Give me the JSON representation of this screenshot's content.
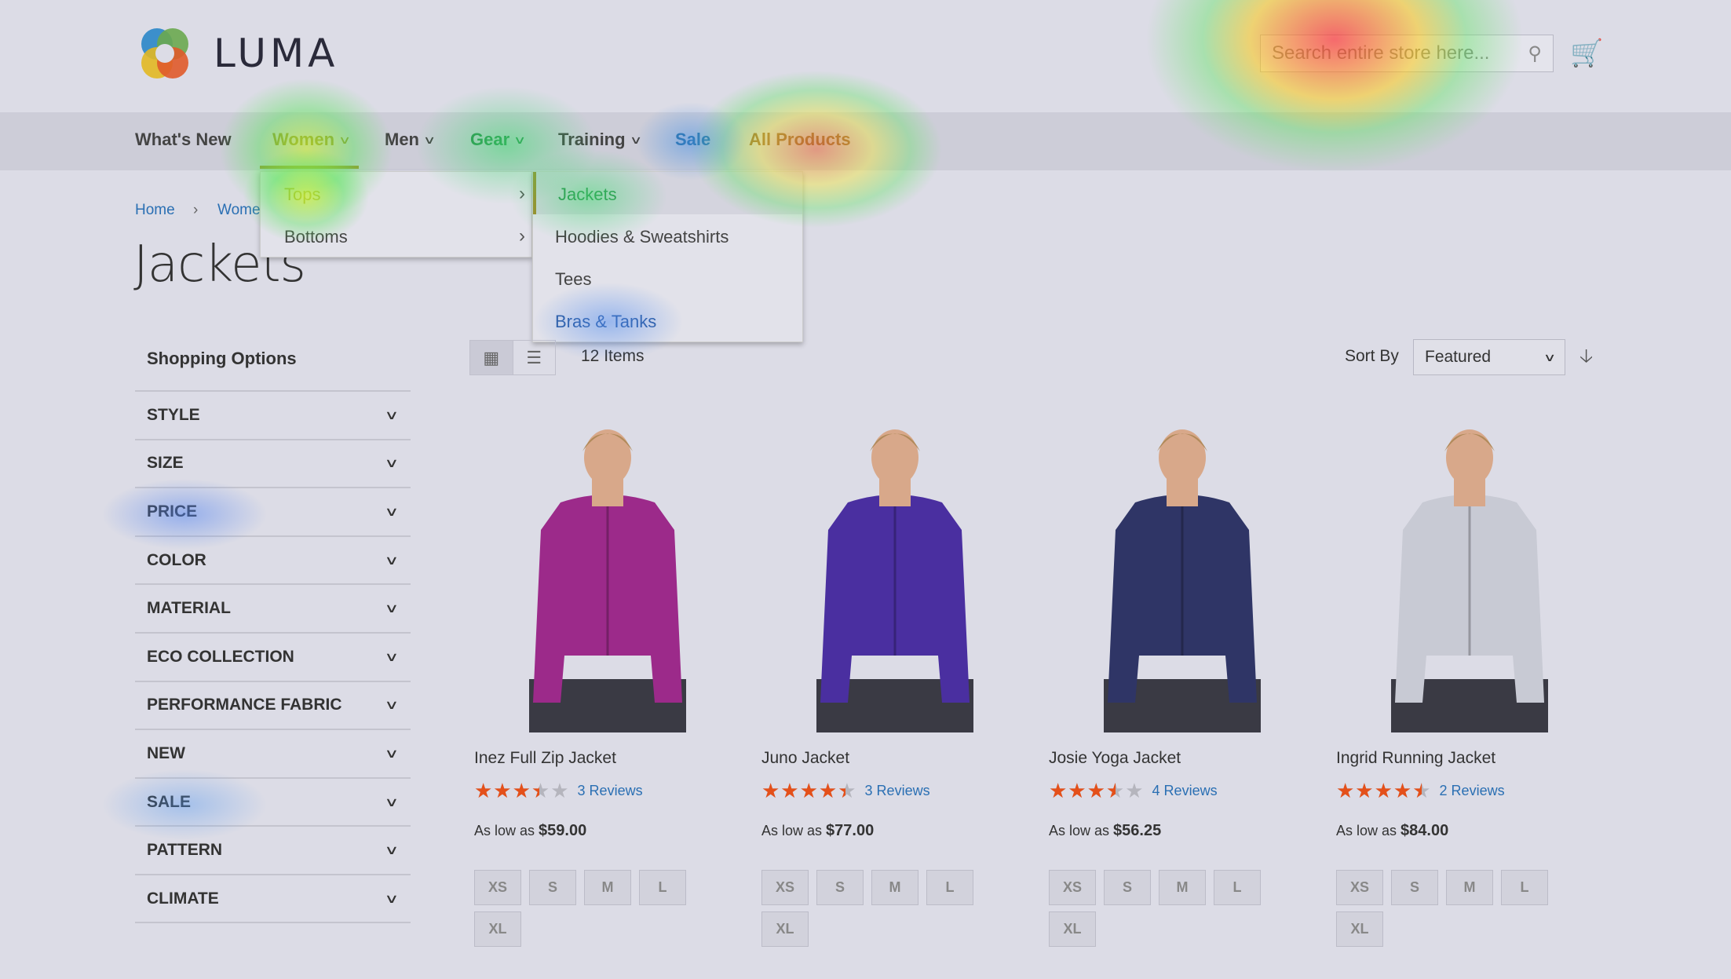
{
  "header": {
    "brand": "LUMA",
    "search_placeholder": "Search entire store here..."
  },
  "nav": [
    {
      "label": "What's New",
      "dropdown": false
    },
    {
      "label": "Women",
      "dropdown": true
    },
    {
      "label": "Men",
      "dropdown": true
    },
    {
      "label": "Gear",
      "dropdown": true
    },
    {
      "label": "Training",
      "dropdown": true
    },
    {
      "label": "Sale",
      "dropdown": false
    },
    {
      "label": "All Products",
      "dropdown": false
    }
  ],
  "menu": {
    "level1": [
      "Tops",
      "Bottoms"
    ],
    "level2": [
      "Jackets",
      "Hoodies & Sweatshirts",
      "Tees",
      "Bras & Tanks"
    ]
  },
  "breadcrumb": [
    "Home",
    "Wome"
  ],
  "page_title": "Jackets",
  "sidebar": {
    "title": "Shopping Options",
    "filters": [
      "STYLE",
      "SIZE",
      "PRICE",
      "COLOR",
      "MATERIAL",
      "ECO COLLECTION",
      "PERFORMANCE FABRIC",
      "NEW",
      "SALE",
      "PATTERN",
      "CLIMATE"
    ]
  },
  "toolbar": {
    "count": "12 Items",
    "sort_label": "Sort By",
    "sort_value": "Featured"
  },
  "price_prefix": "As low as",
  "products": [
    {
      "name": "Inez Full Zip Jacket",
      "rating": 3.4,
      "reviews": "3  Reviews",
      "price": "$59.00",
      "color": "#9c2a8a",
      "sizes": [
        "XS",
        "S",
        "M",
        "L",
        "XL"
      ]
    },
    {
      "name": "Juno Jacket",
      "rating": 4.4,
      "reviews": "3  Reviews",
      "price": "$77.00",
      "color": "#4a2fa0",
      "sizes": [
        "XS",
        "S",
        "M",
        "L",
        "XL"
      ]
    },
    {
      "name": "Josie Yoga Jacket",
      "rating": 3.5,
      "reviews": "4  Reviews",
      "price": "$56.25",
      "color": "#2f3566",
      "sizes": [
        "XS",
        "S",
        "M",
        "L",
        "XL"
      ]
    },
    {
      "name": "Ingrid Running Jacket",
      "rating": 4.5,
      "reviews": "2  Reviews",
      "price": "$84.00",
      "color": "#c8cad4",
      "sizes": [
        "XS",
        "S",
        "M",
        "L",
        "XL"
      ]
    }
  ],
  "colors": {
    "accent_link": "#2a6fb3",
    "star": "#e4501a"
  }
}
